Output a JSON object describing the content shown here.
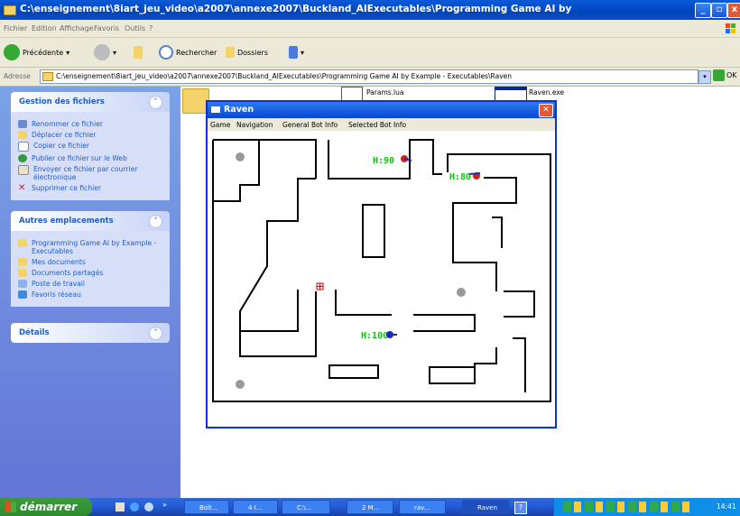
{
  "explorer": {
    "title": "C:\\enseignement\\8iart_jeu_video\\a2007\\annexe2007\\Buckland_AIExecutables\\Programming Game AI by",
    "menu": [
      "Fichier",
      "Edition",
      "Affichage",
      "Favoris",
      "Outils",
      "?"
    ],
    "toolbar": {
      "back": "Précédente",
      "search": "Rechercher",
      "folders": "Dossiers"
    },
    "address_label": "Adresse",
    "address_value": "C:\\enseignement\\8iart_jeu_video\\a2007\\annexe2007\\Buckland_AIExecutables\\Programming Game AI by Example - Executables\\Raven",
    "go_label": "OK"
  },
  "sidebar": {
    "file_tasks": {
      "title": "Gestion des fichiers",
      "items": [
        "Renommer ce fichier",
        "Déplacer ce fichier",
        "Copier ce fichier",
        "Publier ce fichier sur le Web",
        "Envoyer ce fichier par courrier électronique",
        "Supprimer ce fichier"
      ]
    },
    "other_places": {
      "title": "Autres emplacements",
      "items": [
        "Programming Game AI by Example - Executables",
        "Mes documents",
        "Documents partagés",
        "Poste de travail",
        "Favoris réseau"
      ]
    },
    "details": {
      "title": "Détails"
    }
  },
  "files": {
    "params": "Params.lua",
    "raven_exe": "Raven.exe"
  },
  "raven": {
    "title": "Raven",
    "menu": [
      "Game",
      "Navigation",
      "General Bot Info",
      "Selected Bot Info"
    ],
    "bots": [
      {
        "label": "H:90",
        "color": "#cc2222"
      },
      {
        "label": "H:80",
        "color": "#cc2222"
      },
      {
        "label": "H:100",
        "color": "#2222cc"
      }
    ]
  },
  "taskbar": {
    "start": "démarrer",
    "tasks": [
      "Bolt...",
      "4 I...",
      "C:\\...",
      "2 M...",
      "rav...",
      "Raven"
    ],
    "clock": "14:41"
  },
  "colors": {
    "xp_blue": "#0a46d0",
    "panel": "#6f8ee0",
    "hp_text": "#00cc00"
  }
}
